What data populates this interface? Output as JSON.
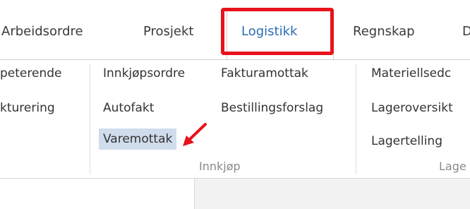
{
  "tabs": [
    {
      "label": "Arbeidsordre",
      "active": false
    },
    {
      "label": "Prosjekt",
      "active": false
    },
    {
      "label": "Logistikk",
      "active": true
    },
    {
      "label": "Regnskap",
      "active": false
    },
    {
      "label": "D",
      "active": false
    }
  ],
  "ribbon": {
    "col1": [
      "peterende",
      "kturering"
    ],
    "col2": [
      "Innkjøpsordre",
      "Autofakt",
      "Varemottak"
    ],
    "col3": [
      "Fakturamottak",
      "Bestillingsforslag"
    ],
    "col4": [
      "Materiellsedc",
      "Lageroversikt",
      "Lagertelling"
    ],
    "groups": {
      "innkjop": "Innkjøp",
      "lager": "Lage"
    }
  },
  "annotation": {
    "highlight_color": "#e8121c",
    "arrow_color": "#e8121c"
  },
  "colors": {
    "active_tab_text": "#2a6db5",
    "selected_item_bg": "#cfdcec"
  }
}
